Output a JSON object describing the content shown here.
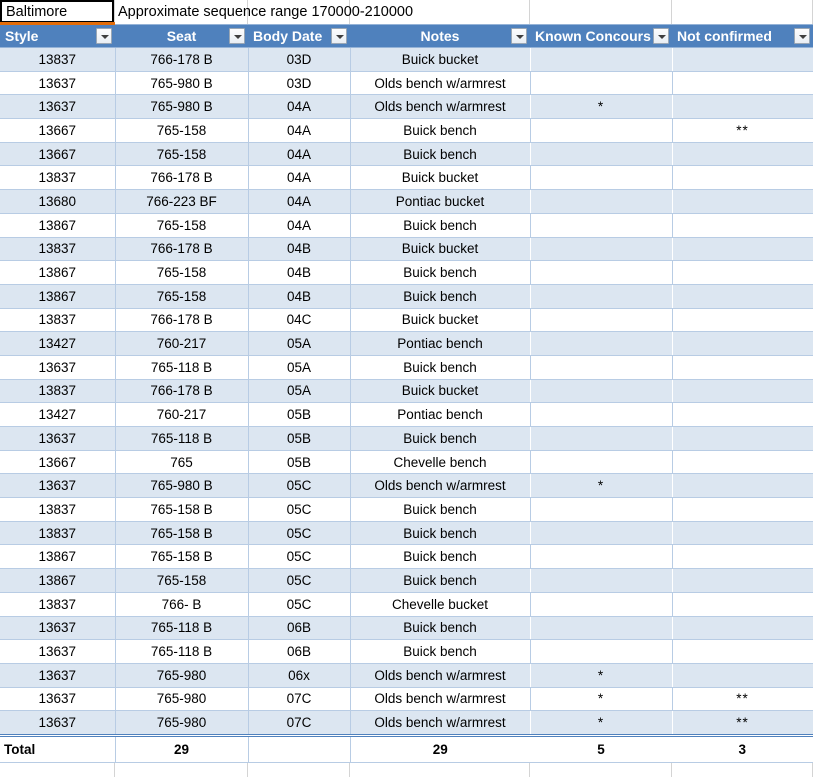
{
  "formula_cell": {
    "value": "Baltimore"
  },
  "note_cell": {
    "text": "Approximate sequence range 170000-210000"
  },
  "colors": {
    "header_blue": "#4F81BD",
    "band_blue": "#DCE6F1",
    "border_blue": "#B8CCE4",
    "selection_orange": "#E36C09"
  },
  "table": {
    "columns": [
      {
        "label": "Style",
        "align": "left",
        "filter": true
      },
      {
        "label": "Seat",
        "align": "center",
        "filter": true
      },
      {
        "label": "Body Date",
        "align": "left",
        "filter": true
      },
      {
        "label": "Notes",
        "align": "center",
        "filter": true
      },
      {
        "label": "Known Concours",
        "align": "left",
        "filter": true
      },
      {
        "label": "Not confirmed",
        "align": "left",
        "filter": true
      }
    ],
    "rows": [
      {
        "style": "13837",
        "seat": "766-178 B",
        "body_date": "03D",
        "notes": "Buick bucket",
        "known_concours": "",
        "not_confirmed": "",
        "shaded": true
      },
      {
        "style": "13637",
        "seat": "765-980 B",
        "body_date": "03D",
        "notes": "Olds bench w/armrest",
        "known_concours": "",
        "not_confirmed": "",
        "shaded": false
      },
      {
        "style": "13637",
        "seat": "765-980 B",
        "body_date": "04A",
        "notes": "Olds bench w/armrest",
        "known_concours": "*",
        "not_confirmed": "",
        "shaded": true
      },
      {
        "style": "13667",
        "seat": "765-158",
        "body_date": "04A",
        "notes": "Buick bench",
        "known_concours": "",
        "not_confirmed": "**",
        "shaded": false
      },
      {
        "style": "13667",
        "seat": "765-158",
        "body_date": "04A",
        "notes": "Buick bench",
        "known_concours": "",
        "not_confirmed": "",
        "shaded": true
      },
      {
        "style": "13837",
        "seat": "766-178 B",
        "body_date": "04A",
        "notes": "Buick bucket",
        "known_concours": "",
        "not_confirmed": "",
        "shaded": false
      },
      {
        "style": "13680",
        "seat": "766-223 BF",
        "body_date": "04A",
        "notes": "Pontiac bucket",
        "known_concours": "",
        "not_confirmed": "",
        "shaded": true
      },
      {
        "style": "13867",
        "seat": "765-158",
        "body_date": "04A",
        "notes": "Buick bench",
        "known_concours": "",
        "not_confirmed": "",
        "shaded": false
      },
      {
        "style": "13837",
        "seat": "766-178 B",
        "body_date": "04B",
        "notes": "Buick bucket",
        "known_concours": "",
        "not_confirmed": "",
        "shaded": true
      },
      {
        "style": "13867",
        "seat": "765-158",
        "body_date": "04B",
        "notes": "Buick bench",
        "known_concours": "",
        "not_confirmed": "",
        "shaded": false
      },
      {
        "style": "13867",
        "seat": "765-158",
        "body_date": "04B",
        "notes": "Buick bench",
        "known_concours": "",
        "not_confirmed": "",
        "shaded": true
      },
      {
        "style": "13837",
        "seat": "766-178 B",
        "body_date": "04C",
        "notes": "Buick bucket",
        "known_concours": "",
        "not_confirmed": "",
        "shaded": false
      },
      {
        "style": "13427",
        "seat": "760-217",
        "body_date": "05A",
        "notes": "Pontiac bench",
        "known_concours": "",
        "not_confirmed": "",
        "shaded": true
      },
      {
        "style": "13637",
        "seat": "765-118 B",
        "body_date": "05A",
        "notes": "Buick bench",
        "known_concours": "",
        "not_confirmed": "",
        "shaded": false
      },
      {
        "style": "13837",
        "seat": "766-178 B",
        "body_date": "05A",
        "notes": "Buick bucket",
        "known_concours": "",
        "not_confirmed": "",
        "shaded": true
      },
      {
        "style": "13427",
        "seat": "760-217",
        "body_date": "05B",
        "notes": "Pontiac bench",
        "known_concours": "",
        "not_confirmed": "",
        "shaded": false
      },
      {
        "style": "13637",
        "seat": "765-118 B",
        "body_date": "05B",
        "notes": "Buick bench",
        "known_concours": "",
        "not_confirmed": "",
        "shaded": true
      },
      {
        "style": "13667",
        "seat": "765",
        "body_date": "05B",
        "notes": "Chevelle bench",
        "known_concours": "",
        "not_confirmed": "",
        "shaded": false
      },
      {
        "style": "13637",
        "seat": "765-980 B",
        "body_date": "05C",
        "notes": "Olds bench w/armrest",
        "known_concours": "*",
        "not_confirmed": "",
        "shaded": true
      },
      {
        "style": "13837",
        "seat": "765-158 B",
        "body_date": "05C",
        "notes": "Buick bench",
        "known_concours": "",
        "not_confirmed": "",
        "shaded": false
      },
      {
        "style": "13837",
        "seat": "765-158 B",
        "body_date": "05C",
        "notes": "Buick bench",
        "known_concours": "",
        "not_confirmed": "",
        "shaded": true
      },
      {
        "style": "13867",
        "seat": "765-158 B",
        "body_date": "05C",
        "notes": "Buick bench",
        "known_concours": "",
        "not_confirmed": "",
        "shaded": false
      },
      {
        "style": "13867",
        "seat": "765-158",
        "body_date": "05C",
        "notes": "Buick bench",
        "known_concours": "",
        "not_confirmed": "",
        "shaded": true
      },
      {
        "style": "13837",
        "seat": "766-  B",
        "body_date": "05C",
        "notes": "Chevelle bucket",
        "known_concours": "",
        "not_confirmed": "",
        "shaded": false
      },
      {
        "style": "13637",
        "seat": "765-118 B",
        "body_date": "06B",
        "notes": "Buick bench",
        "known_concours": "",
        "not_confirmed": "",
        "shaded": true
      },
      {
        "style": "13637",
        "seat": "765-118 B",
        "body_date": "06B",
        "notes": "Buick bench",
        "known_concours": "",
        "not_confirmed": "",
        "shaded": false
      },
      {
        "style": "13637",
        "seat": "765-980",
        "body_date": "06x",
        "notes": "Olds bench w/armrest",
        "known_concours": "*",
        "not_confirmed": "",
        "shaded": true
      },
      {
        "style": "13637",
        "seat": "765-980",
        "body_date": "07C",
        "notes": "Olds bench w/armrest",
        "known_concours": "*",
        "not_confirmed": "**",
        "shaded": false
      },
      {
        "style": "13637",
        "seat": "765-980",
        "body_date": "07C",
        "notes": "Olds bench w/armrest",
        "known_concours": "*",
        "not_confirmed": "**",
        "shaded": true
      }
    ],
    "total_row": {
      "label": "Total",
      "seat_count": "29",
      "body_date": "",
      "notes_count": "29",
      "known_concours_count": "5",
      "not_confirmed_count": "3"
    }
  }
}
